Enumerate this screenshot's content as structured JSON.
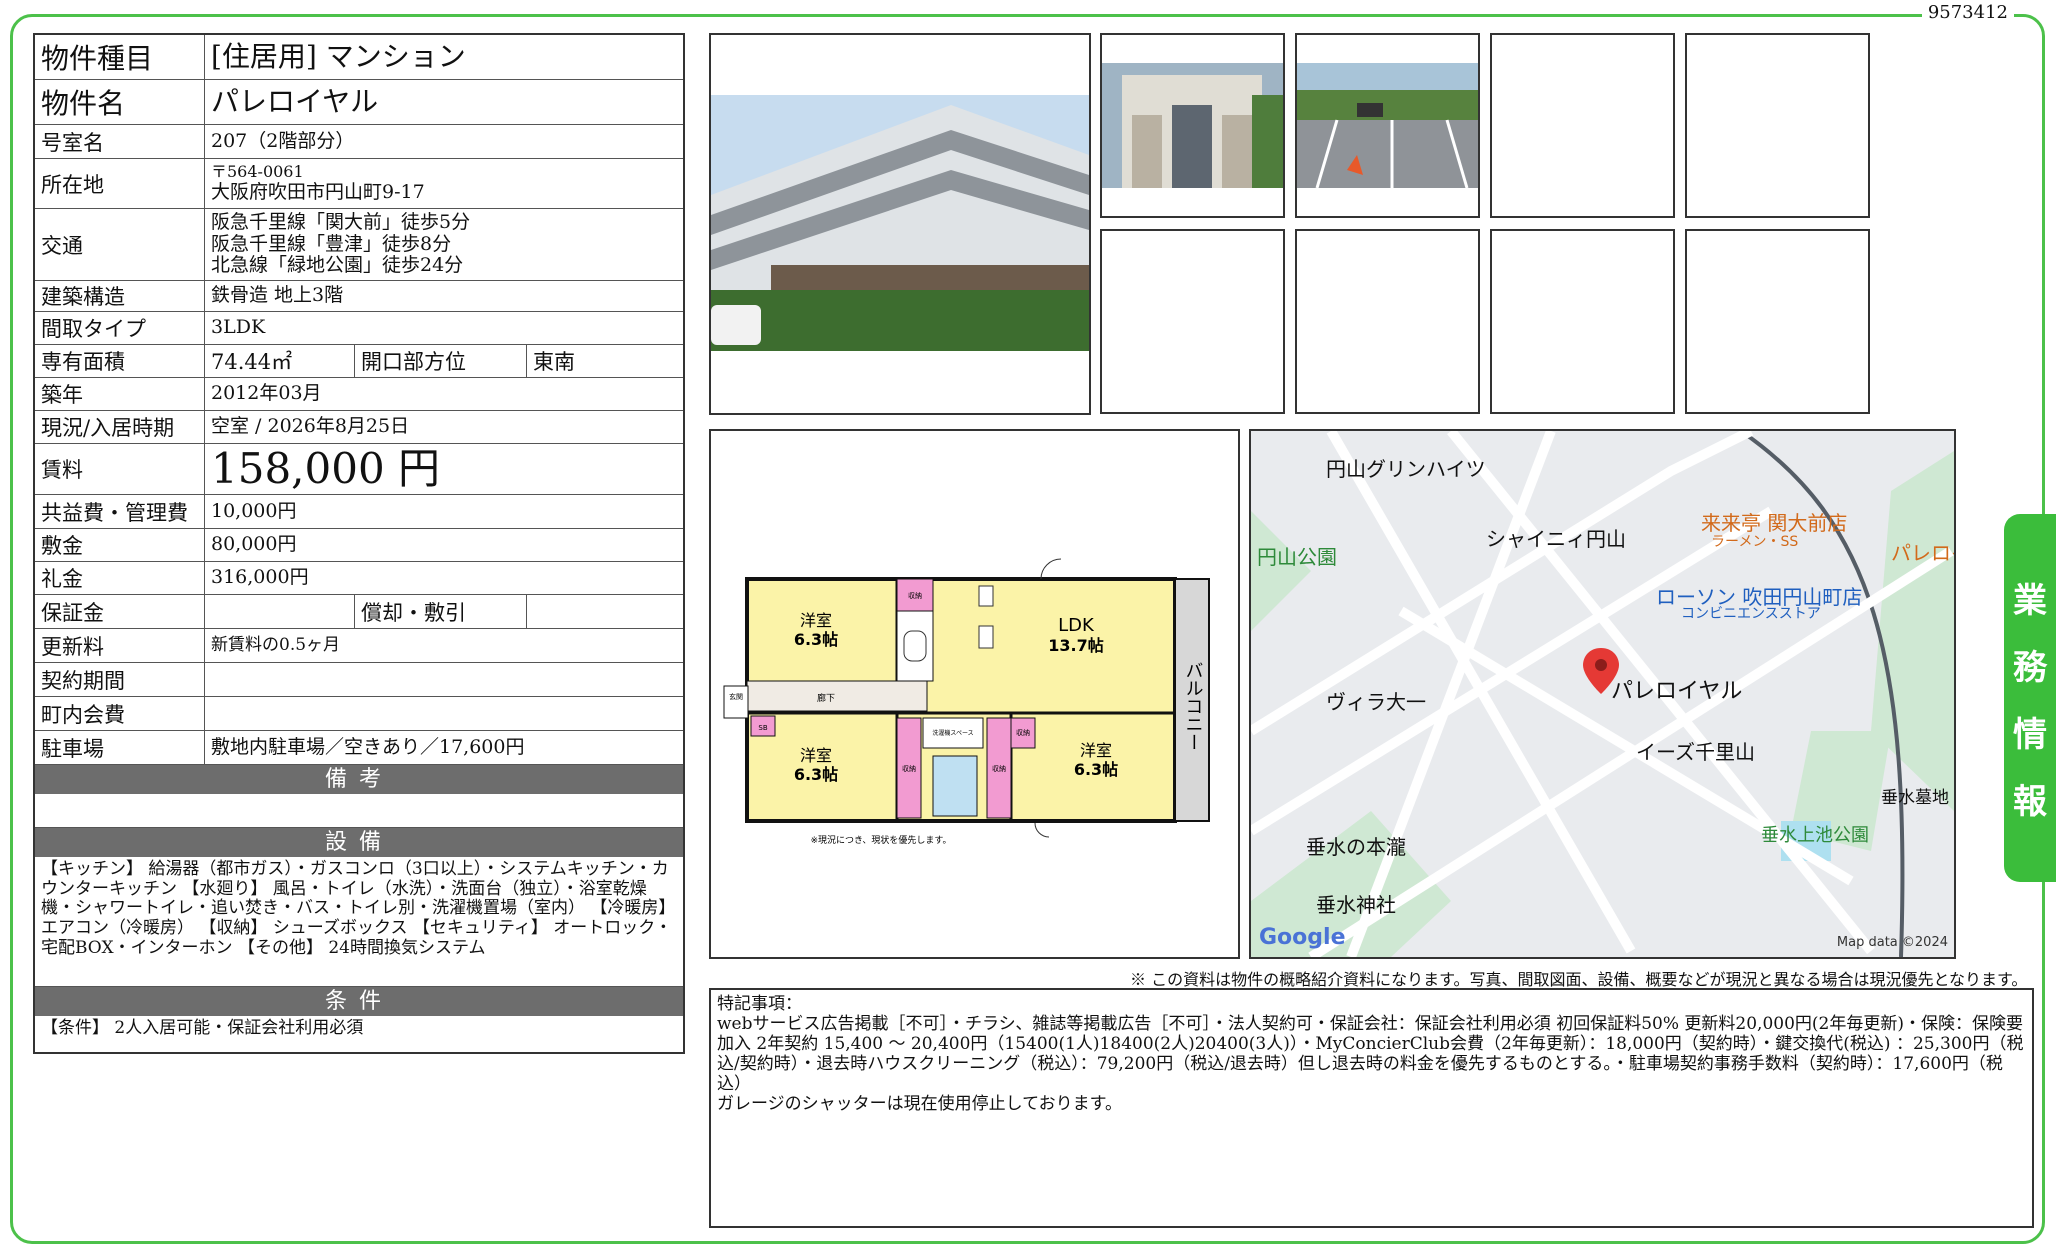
{
  "doc_no": "9573412",
  "side_tab": [
    "業",
    "務",
    "情",
    "報"
  ],
  "info": {
    "type_label": "物件種目",
    "type_value": "[住居用] マンション",
    "name_label": "物件名",
    "name_value": "パレロイヤル",
    "room_label": "号室名",
    "room_value": "207（2階部分）",
    "address_label": "所在地",
    "address_zip": "〒564-0061",
    "address_value": "大阪府吹田市円山町9-17",
    "transport_label": "交通",
    "transport": [
      "阪急千里線「関大前」徒歩5分",
      "阪急千里線「豊津」徒歩8分",
      "北急線「緑地公園」徒歩24分"
    ],
    "structure_label": "建築構造",
    "structure_value": "鉄骨造 地上3階",
    "layout_label": "間取タイプ",
    "layout_value": "3LDK",
    "area_label": "専有面積",
    "area_value": "74.44㎡",
    "direction_label": "開口部方位",
    "direction_value": "東南",
    "built_label": "築年",
    "built_value": "2012年03月",
    "status_label": "現況/入居時期",
    "status_value": "空室 / 2026年8月25日",
    "rent_label": "賃料",
    "rent_value": "158,000 円",
    "fee_label": "共益費・管理費",
    "fee_value": "10,000円",
    "deposit_label": "敷金",
    "deposit_value": "80,000円",
    "key_label": "礼金",
    "key_value": "316,000円",
    "guarantee_label": "保証金",
    "guarantee_value": "",
    "amort_label": "償却・敷引",
    "amort_value": "",
    "renewal_label": "更新料",
    "renewal_value": "新賃料の0.5ヶ月",
    "contract_label": "契約期間",
    "contract_value": "",
    "town_label": "町内会費",
    "town_value": "",
    "parking_label": "駐車場",
    "parking_value": "敷地内駐車場／空きあり／17,600円",
    "remarks_band": "備考",
    "remarks_value": "",
    "equip_band": "設備",
    "equip_value": "【キッチン】 給湯器（都市ガス）・ガスコンロ（3口以上）・システムキッチン・カウンターキッチン 【水廻り】 風呂・トイレ（水洗）・洗面台（独立）・浴室乾燥機・シャワートイレ・追い焚き・バス・トイレ別・洗濯機置場（室内） 【冷暖房】 エアコン（冷暖房） 【収納】 シューズボックス 【セキュリティ】 オートロック・宅配BOX・インターホン 【その他】 24時間換気システム",
    "cond_band": "条件",
    "cond_value": "【条件】 2人入居可能・保証会社利用必須"
  },
  "plan": {
    "room_a": "洋室",
    "room_a_size": "6.3帖",
    "room_ldk": "LDK",
    "room_ldk_size": "13.7帖",
    "room_b": "洋室",
    "room_b_size": "6.3帖",
    "room_c": "洋室",
    "room_c_size": "6.3帖",
    "balcony": "バルコニー",
    "hall": "廊下",
    "entrance": "玄関",
    "storage": "収納",
    "washroom": "洗濯機スペース",
    "shoes": "SB",
    "note": "※現況につき、現状を優先します。"
  },
  "map": {
    "pois": [
      "円山グリンハイツ",
      "シャイニィ円山",
      "円山公園",
      "来来亭 関大前店",
      "ラーメン・SS",
      "パレロイ",
      "ローソン 吹田円山町店",
      "コンビニエンスストア",
      "ヴィラ大一",
      "パレロイヤル",
      "イーズ千里山",
      "垂水墓地",
      "垂水上池公園",
      "垂水の本瀧",
      "垂水神社"
    ],
    "google": "Google",
    "credit": "Map data ©2024"
  },
  "disclaimer": "※ この資料は物件の概略紹介資料になります。写真、間取図面、設備、概要などが現況と異なる場合は現況優先となります。",
  "remarks": {
    "title": "特記事項：",
    "body": "webサービス広告掲載［不可］・チラシ、雑誌等掲載広告［不可］・法人契約可・保証会社：保証会社利用必須 初回保証料50% 更新料20,000円(2年毎更新)・保険：保険要加入 2年契約 15,400 ～ 20,400円（15400(1人)18400(2人)20400(3人)）・MyConcierClub会費（2年毎更新）：18,000円（契約時）・鍵交換代(税込) ：25,300円（税込/契約時）・退去時ハウスクリーニング（税込）：79,200円（税込/退去時）但し退去時の料金を優先するものとする。・駐車場契約事務手数料（契約時）：17,600円（税込）",
    "body2": "ガレージのシャッターは現在使用停止しております。"
  },
  "colors": {
    "frame": "#4cc14a",
    "band": "#6d6d6d",
    "room_fill": "#fbf3a8",
    "storage_fill": "#f29bd1"
  }
}
